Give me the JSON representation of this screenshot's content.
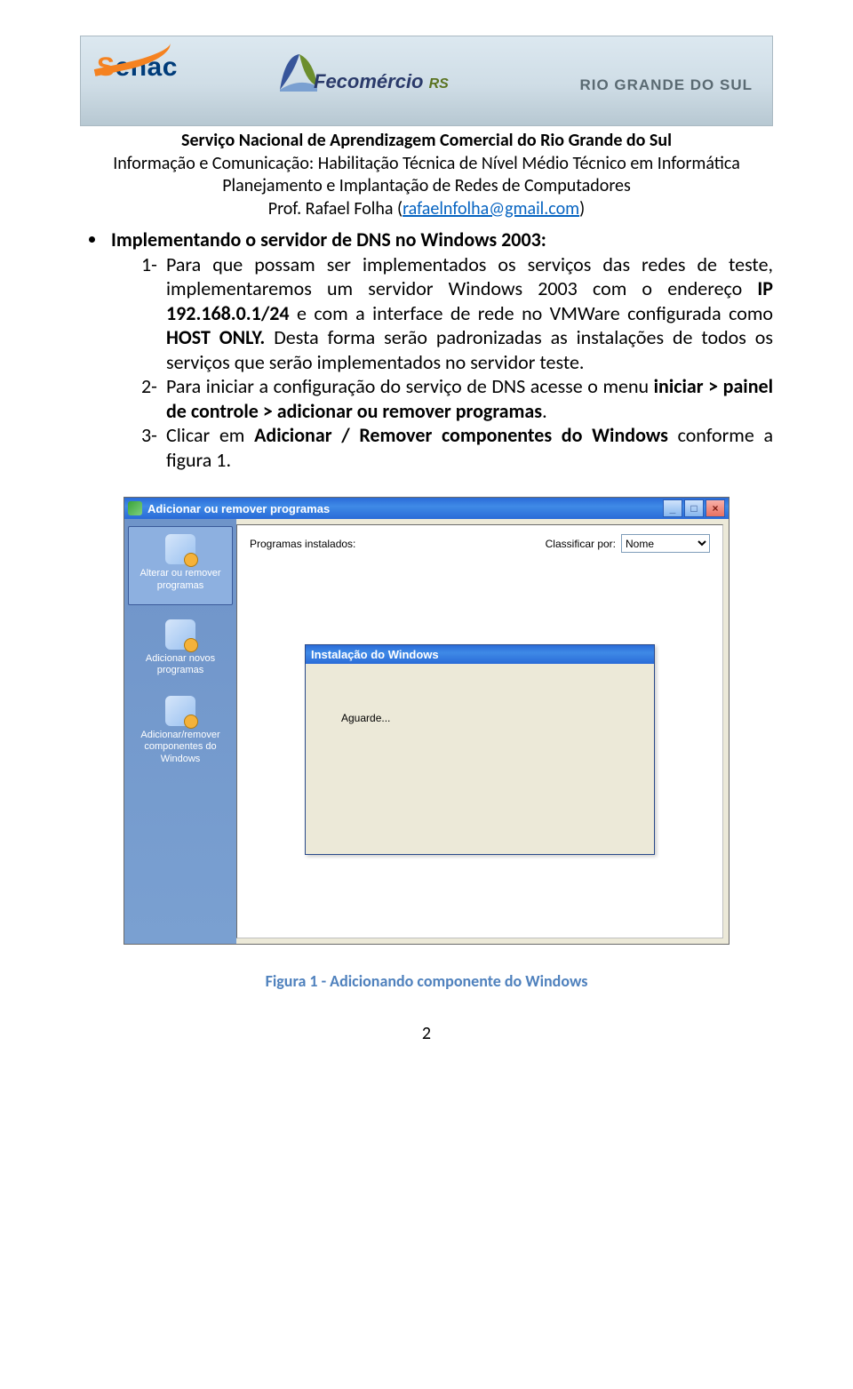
{
  "banner": {
    "senac_text": "Senac",
    "fecomercio_text": "Fecomércio",
    "fecomercio_rs": "RS",
    "rgs": "RIO GRANDE DO SUL"
  },
  "header": {
    "l1": "Serviço Nacional de Aprendizagem Comercial do Rio Grande do Sul",
    "l2": "Informação e Comunicação: Habilitação Técnica de Nível Médio Técnico em Informática",
    "l3": "Planejamento e Implantação de Redes de Computadores",
    "l4_prefix": "Prof. Rafael Folha (",
    "l4_email": "rafaelnfolha@gmail.com",
    "l4_suffix": ")"
  },
  "content": {
    "bullet_title": "Implementando o servidor de DNS no Windows 2003:",
    "item1_a": "Para que possam ser implementados os serviços das redes de teste, implementaremos um servidor Windows 2003 com o endereço ",
    "item1_ip": "IP 192.168.0.1/24",
    "item1_b": " e com a interface de rede no VMWare configurada como ",
    "item1_host": "HOST ONLY.",
    "item1_c": " Desta forma serão padronizadas as instalações de todos os serviços que serão implementados no servidor teste.",
    "item2_a": "Para iniciar a configuração do serviço de DNS acesse o menu ",
    "item2_b1": "iniciar > painel de controle > adicionar ou remover programas",
    "item2_c": ".",
    "item3_a": "Clicar em ",
    "item3_b": "Adicionar / Remover componentes do Windows",
    "item3_c": " conforme a figura 1."
  },
  "win": {
    "title": "Adicionar ou remover programas",
    "side1": "Alterar ou remover programas",
    "side2": "Adicionar novos programas",
    "side3": "Adicionar/remover componentes do Windows",
    "label_left": "Programas instalados:",
    "label_right": "Classificar por:",
    "select_value": "Nome",
    "modal_title": "Instalação do Windows",
    "modal_body": "Aguarde..."
  },
  "caption": "Figura 1 - Adicionando componente do Windows",
  "pagenum": "2"
}
